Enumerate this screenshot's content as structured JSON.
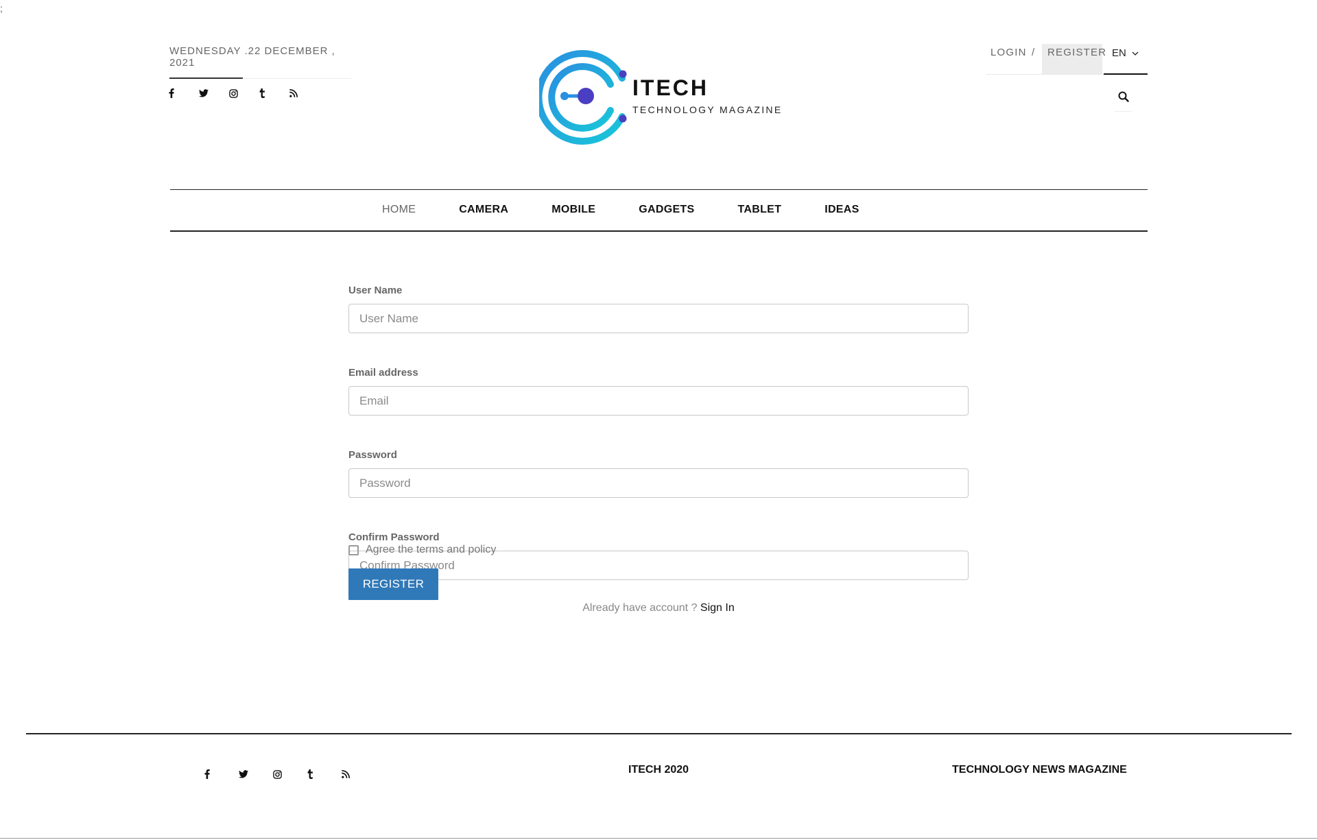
{
  "stray_mark": ";",
  "header": {
    "date": "WEDNESDAY .22 DECEMBER , 2021",
    "social": [
      "facebook-icon",
      "twitter-icon",
      "instagram-icon",
      "tumblr-icon",
      "rss-icon"
    ],
    "logo": {
      "title": "ITECH",
      "subtitle": "TECHNOLOGY MAGAZINE"
    },
    "auth": {
      "login": "LOGIN",
      "separator": "/",
      "register": "REGISTER",
      "language": "EN"
    }
  },
  "nav": {
    "items": [
      "HOME",
      "CAMERA",
      "MOBILE",
      "GADGETS",
      "TABLET",
      "IDEAS"
    ],
    "active": "HOME"
  },
  "form": {
    "username": {
      "label": "User Name",
      "placeholder": "User Name",
      "value": ""
    },
    "email": {
      "label": "Email address",
      "placeholder": "Email",
      "value": ""
    },
    "password": {
      "label": "Password",
      "placeholder": "Password",
      "value": ""
    },
    "confirm": {
      "label": "Confirm Password",
      "placeholder": "Confirm Password",
      "value": ""
    },
    "agree": {
      "label": "Agree the terms and policy",
      "checked": false
    },
    "submit": "REGISTER",
    "already": "Already have account ?",
    "signin": "Sign In"
  },
  "footer": {
    "social": [
      "facebook-icon",
      "twitter-icon",
      "instagram-icon",
      "tumblr-icon",
      "rss-icon"
    ],
    "copyright": "ITECH 2020",
    "tagline": "TECHNOLOGY NEWS MAGAZINE"
  },
  "colors": {
    "primary_button": "#3079b8",
    "logo_cyan": "#1ab0de",
    "logo_indigo": "#4a3fc2",
    "rule": "#222222"
  }
}
